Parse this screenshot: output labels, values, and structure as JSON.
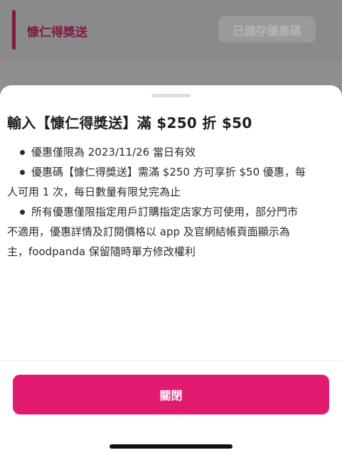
{
  "voucher": {
    "title": "慷仁得獎送",
    "saved_label": "已儲存優惠碼"
  },
  "sheet": {
    "title": "輸入【慷仁得獎送】滿 $250 折 $50",
    "terms": [
      {
        "lines": [
          "優惠僅限為 2023/11/26 當日有效"
        ]
      },
      {
        "lines": [
          "優惠碼【慷仁得獎送】需滿 $250 方可享折 $50 優惠，每",
          "人可用 1 次，每日數量有限兌完為止"
        ]
      },
      {
        "lines": [
          "所有優惠僅限指定用戶訂購指定店家方可使用，部分門市",
          "不適用，優惠詳情及訂閱價格以 app 及官網結帳頁面顯示為",
          "主，foodpanda 保留隨時單方修改權利"
        ]
      }
    ],
    "close_label": "關閉"
  },
  "colors": {
    "brand_pink": "#e21b70",
    "overlay": "#8f8f8f"
  }
}
